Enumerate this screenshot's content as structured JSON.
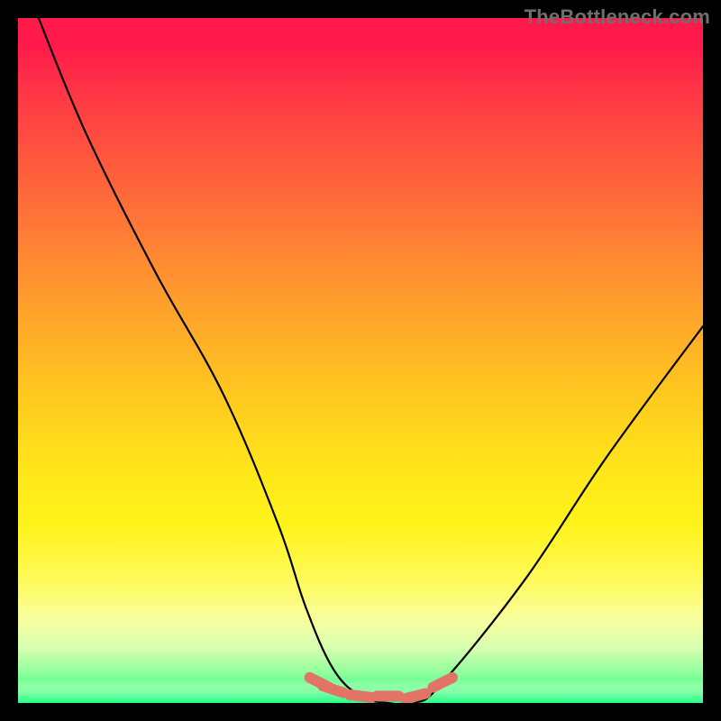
{
  "watermark": "TheBottleneck.com",
  "colors": {
    "frame": "#000000",
    "watermark": "#6f6f6f",
    "curve": "#000000",
    "marker": "#e27367",
    "gradient_top": "#ff1a4b",
    "gradient_bottom": "#26ff87"
  },
  "chart_data": {
    "type": "line",
    "title": "",
    "xlabel": "",
    "ylabel": "",
    "xlim": [
      0,
      100
    ],
    "ylim": [
      0,
      100
    ],
    "grid": false,
    "legend": false,
    "series": [
      {
        "name": "bottleneck-curve",
        "x": [
          3,
          10,
          20,
          30,
          38,
          42,
          46,
          50,
          54,
          58,
          62,
          74,
          86,
          100
        ],
        "values": [
          100,
          83,
          63,
          45,
          26,
          14,
          5,
          1,
          0,
          0,
          3,
          18,
          36,
          55
        ]
      }
    ],
    "annotations": [
      {
        "name": "trough-marker",
        "x": 44,
        "y": 3
      },
      {
        "name": "trough-marker",
        "x": 46,
        "y": 2
      },
      {
        "name": "trough-marker",
        "x": 50,
        "y": 1
      },
      {
        "name": "trough-marker",
        "x": 54,
        "y": 1
      },
      {
        "name": "trough-marker",
        "x": 58,
        "y": 1
      },
      {
        "name": "trough-marker",
        "x": 62,
        "y": 3
      }
    ]
  }
}
